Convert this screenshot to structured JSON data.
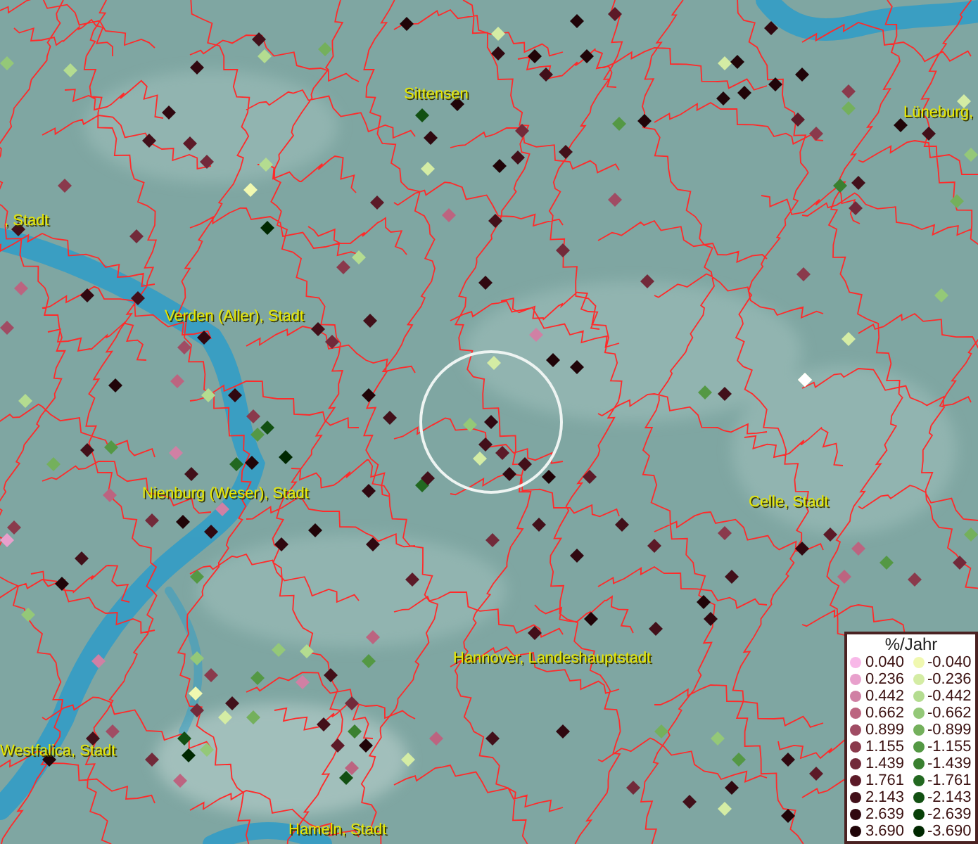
{
  "map_labels": [
    {
      "text": ", Stadt"
    },
    {
      "text": "Sittensen"
    },
    {
      "text": "Lüneburg,"
    },
    {
      "text": "Verden (Aller), Stadt"
    },
    {
      "text": "Nienburg (Weser), Stadt"
    },
    {
      "text": "Celle, Stadt"
    },
    {
      "text": "Hannover, Landeshauptstadt"
    },
    {
      "text": "Westfalica, Stadt"
    },
    {
      "text": "Hameln, Stadt"
    }
  ],
  "legend": {
    "title": "%/Jahr",
    "increase": [
      {
        "label": "0.040",
        "color": "#f8b8e8"
      },
      {
        "label": "0.236",
        "color": "#e8a0cc"
      },
      {
        "label": "0.442",
        "color": "#d080a4"
      },
      {
        "label": "0.662",
        "color": "#bc6480"
      },
      {
        "label": "0.899",
        "color": "#a04c64"
      },
      {
        "label": "1.155",
        "color": "#8a3a4c"
      },
      {
        "label": "1.439",
        "color": "#722a3a"
      },
      {
        "label": "1.761",
        "color": "#5c1a28"
      },
      {
        "label": "2.143",
        "color": "#42101a"
      },
      {
        "label": "2.639",
        "color": "#300810"
      },
      {
        "label": "3.690",
        "color": "#200408"
      }
    ],
    "decrease": [
      {
        "label": "-0.040",
        "color": "#f0f8b0"
      },
      {
        "label": "-0.236",
        "color": "#d4eca4"
      },
      {
        "label": "-0.442",
        "color": "#b4dc90"
      },
      {
        "label": "-0.662",
        "color": "#94c878"
      },
      {
        "label": "-0.899",
        "color": "#74b05c"
      },
      {
        "label": "-1.155",
        "color": "#549844"
      },
      {
        "label": "-1.439",
        "color": "#3a8030"
      },
      {
        "label": "-1.761",
        "color": "#226820"
      },
      {
        "label": "-2.143",
        "color": "#125012"
      },
      {
        "label": "-2.639",
        "color": "#084008"
      },
      {
        "label": "-3.690",
        "color": "#002800"
      }
    ]
  }
}
